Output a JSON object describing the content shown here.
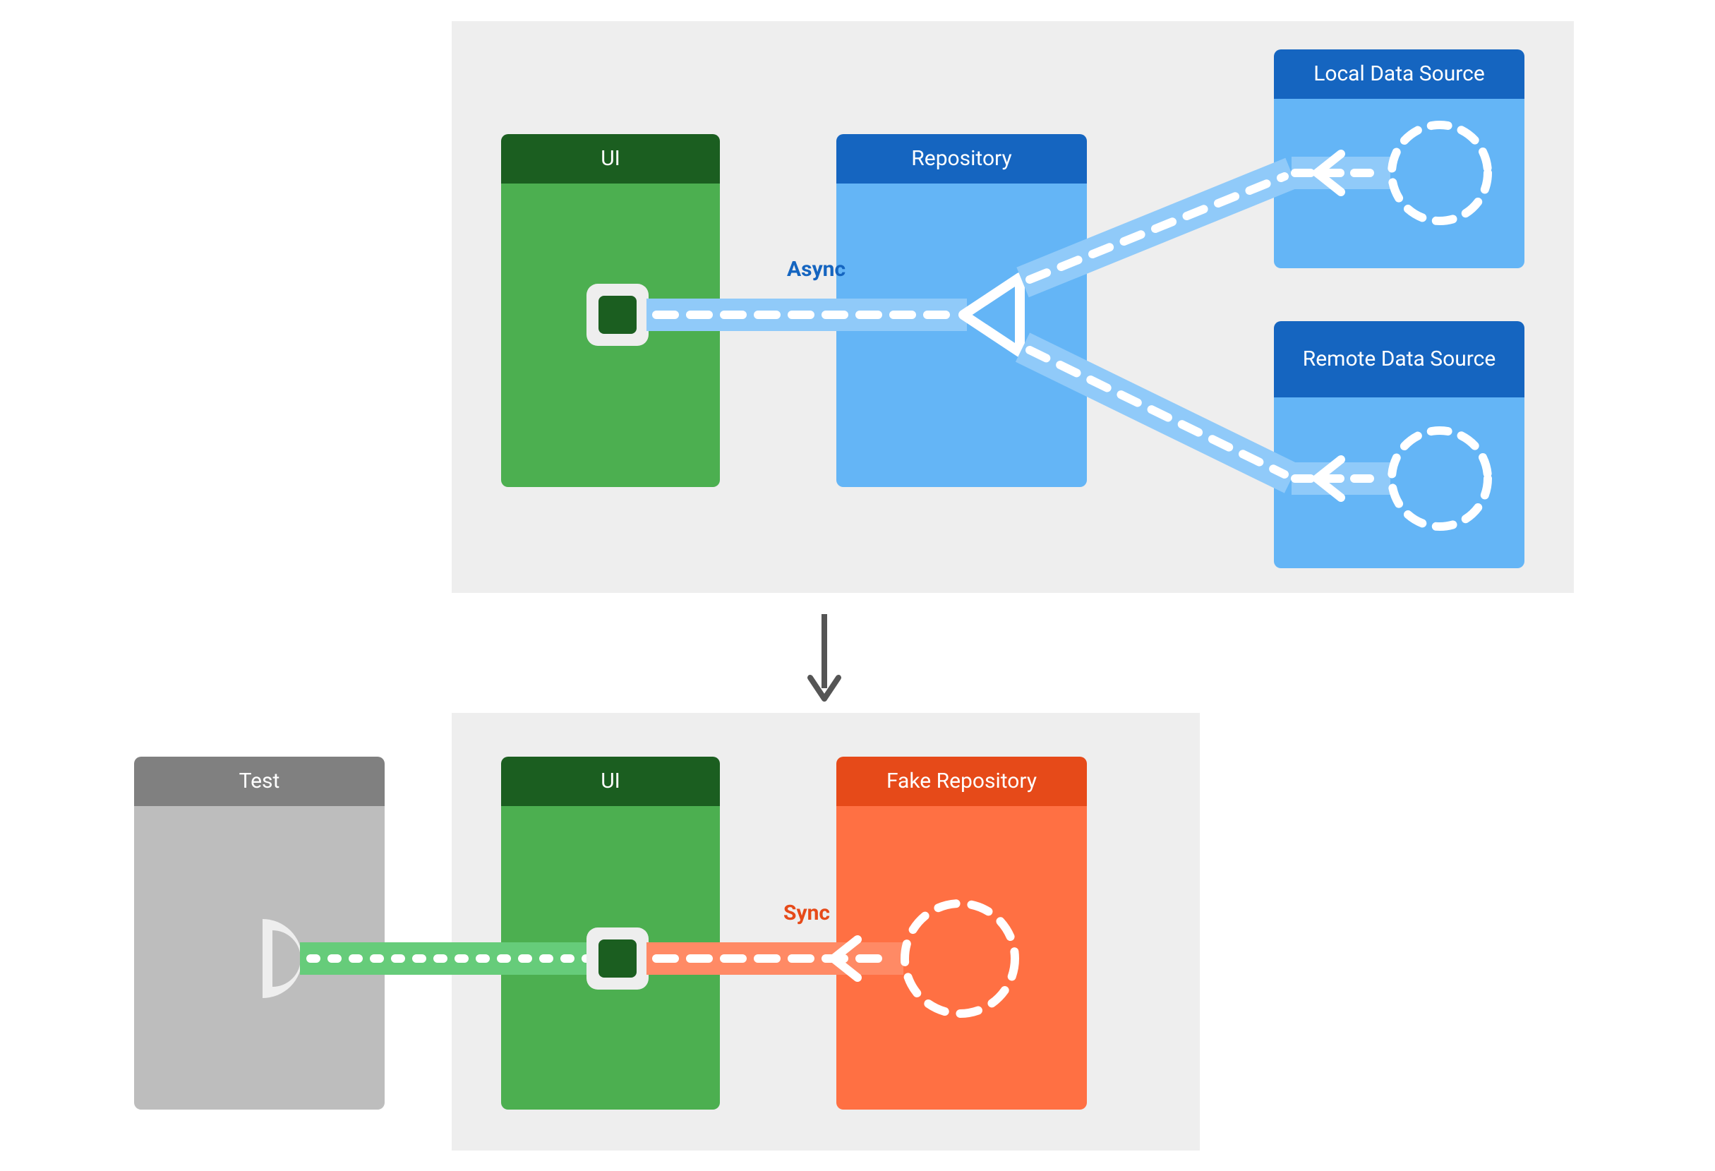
{
  "colors": {
    "panel": "#eeeeee",
    "greenHeader": "#1b5e20",
    "greenBody": "#4caf50",
    "greenLight": "#66cc7a",
    "blueHeader": "#1565c0",
    "blueBody": "#64b5f6",
    "blueLight": "#90caf9",
    "orangeHeader": "#e64a19",
    "orangeBody": "#ff7043",
    "orangeLight": "#ff8a65",
    "greyHeader": "#808080",
    "greyBody": "#bdbdbd",
    "arrowGrey": "#555555",
    "white": "#ffffff"
  },
  "top": {
    "ui": {
      "label": "UI"
    },
    "repository": {
      "label": "Repository"
    },
    "localDataSource": {
      "label": "Local Data Source"
    },
    "remoteDataSource": {
      "label": "Remote Data Source"
    },
    "asyncLabel": "Async"
  },
  "bottom": {
    "test": {
      "label": "Test"
    },
    "ui": {
      "label": "UI"
    },
    "fakeRepository": {
      "label": "Fake Repository"
    },
    "syncLabel": "Sync"
  }
}
